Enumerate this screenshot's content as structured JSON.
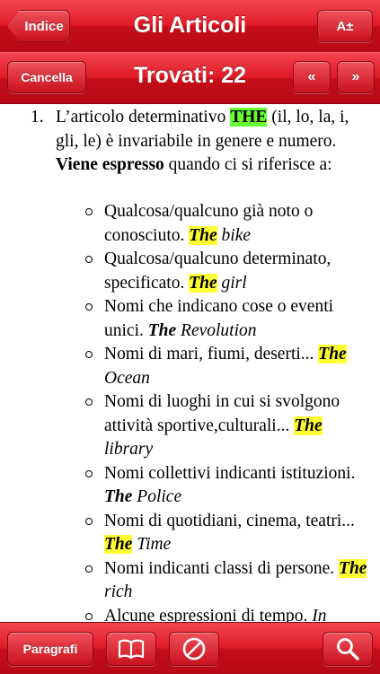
{
  "nav": {
    "back_label": "Indice",
    "title": "Gli Articoli",
    "font_button_label": "A±"
  },
  "search_bar": {
    "cancel_label": "Cancella",
    "results_title": "Trovati: 22",
    "prev_label": "«",
    "next_label": "»"
  },
  "content": {
    "item_number": "1.",
    "intro_before": "L’articolo determinativo ",
    "intro_highlight": "THE",
    "intro_after": " (il, lo, la, i, gli, le) è invariabile in genere e numero.",
    "subhead_bold": "Viene espresso",
    "subhead_rest": " quando ci si riferisce a:",
    "bullets": [
      {
        "text": "Qualcosa/qualcuno già noto o conosciuto. ",
        "the": "The",
        "example": " bike",
        "highlight": true
      },
      {
        "text": "Qualcosa/qualcuno determinato, specificato. ",
        "the": "The",
        "example": " girl",
        "highlight": true
      },
      {
        "text": "Nomi che indicano cose o eventi unici. ",
        "the": "The",
        "example": " Revolution",
        "highlight": false
      },
      {
        "text": "Nomi di mari, fiumi, deserti... ",
        "the": "The",
        "example": " Ocean",
        "highlight": true
      },
      {
        "text": "Nomi di luoghi in cui si svolgono attività sportive,culturali... ",
        "the": "The",
        "example": " library",
        "highlight": true
      },
      {
        "text": "Nomi collettivi indicanti istituzioni. ",
        "the": "The",
        "example": " Police",
        "highlight": false
      },
      {
        "text": "Nomi di quotidiani, cinema, teatri... ",
        "the": "The",
        "example": " Time",
        "highlight": true
      },
      {
        "text": "Nomi indicanti classi di persone. ",
        "the": "The",
        "example": " rich",
        "highlight": true
      },
      {
        "text": "Alcune espressioni di tempo. ",
        "the": "In",
        "example": "",
        "highlight": false
      }
    ]
  },
  "toolbar": {
    "paragraphs_label": "Paragrafi",
    "book_icon": "book-icon",
    "circle_icon": "slash-circle-icon",
    "search_icon": "search-icon"
  },
  "colors": {
    "bar_red": "#e01b27",
    "highlight_green": "#66ff33",
    "highlight_yellow": "#ffff33"
  }
}
